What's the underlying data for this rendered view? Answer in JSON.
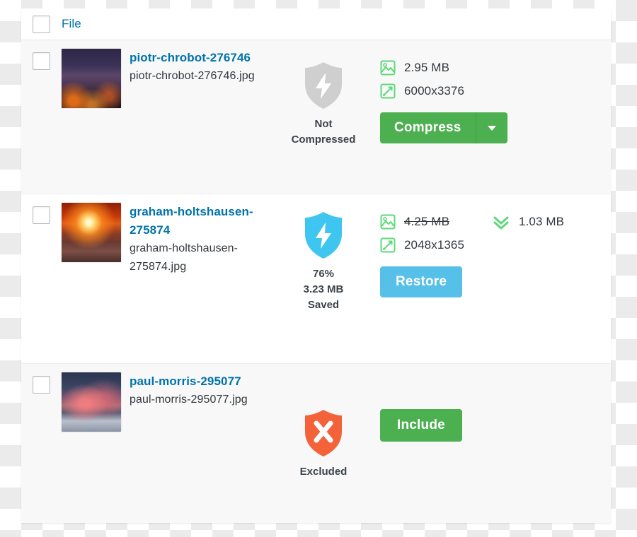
{
  "panel": {
    "header": {
      "select_all_checkbox": "unchecked",
      "file_column_label": "File"
    }
  },
  "colors": {
    "link_blue": "#0073aa",
    "green_button": "#4caf50",
    "blue_button": "#56c0e8",
    "green_icon": "#5ed97a",
    "shield_gray": "#cfcfcf",
    "shield_blue": "#3ec6f0",
    "shield_red": "#f4623a",
    "text_dark": "#32373c",
    "row_alt_bg": "#f8f8f8"
  },
  "rows": [
    {
      "checkbox": "unchecked",
      "thumbnail": "city-skyline-thumbnail",
      "title": "piotr-chrobot-276746",
      "filename": "piotr-chrobot-276746.jpg",
      "status": {
        "icon": "shield-bolt-gray-icon",
        "lines": [
          "Not",
          "Compressed"
        ]
      },
      "stats": {
        "size_icon": "image-icon",
        "size": "2.95 MB",
        "dimensions_icon": "resize-icon",
        "dimensions": "6000x3376",
        "saved_visible": false
      },
      "action": {
        "type": "split-button",
        "label": "Compress",
        "caret_icon": "caret-down-icon",
        "color": "#4caf50"
      }
    },
    {
      "checkbox": "unchecked",
      "thumbnail": "sunset-sea-stacks-thumbnail",
      "title": "graham-holtshausen-275874",
      "filename": "graham-holtshausen-275874.jpg",
      "status": {
        "icon": "shield-bolt-blue-icon",
        "lines": [
          "76%",
          "3.23 MB",
          "Saved"
        ]
      },
      "stats": {
        "size_icon": "image-icon",
        "size": "4.25 MB",
        "size_struck": true,
        "dimensions_icon": "resize-icon",
        "dimensions": "2048x1365",
        "saved_visible": true,
        "saved_icon": "double-chevron-down-icon",
        "saved_size": "1.03 MB"
      },
      "action": {
        "type": "button",
        "label": "Restore",
        "color": "#56c0e8"
      }
    },
    {
      "checkbox": "unchecked",
      "thumbnail": "mountain-dusk-thumbnail",
      "title": "paul-morris-295077",
      "filename": "paul-morris-295077.jpg",
      "status": {
        "icon": "shield-x-red-icon",
        "lines": [
          "Excluded"
        ]
      },
      "stats": {
        "visible": false
      },
      "action": {
        "type": "button",
        "label": "Include",
        "color": "#4caf50"
      }
    }
  ]
}
